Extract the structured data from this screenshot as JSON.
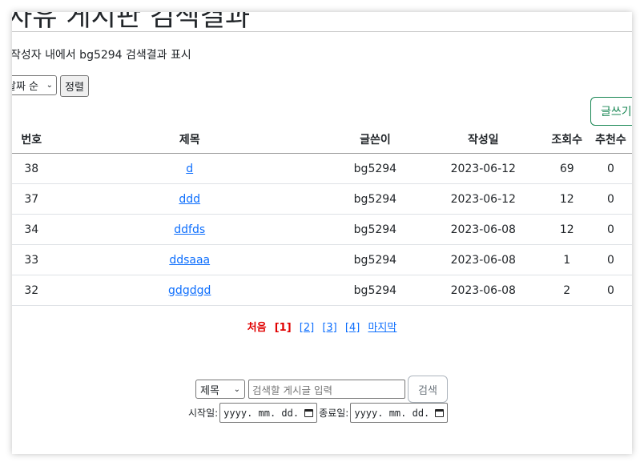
{
  "page": {
    "title": "자유 게시판 검색결과",
    "summary": "작성자 내에서 bg5294 검색결과 표시"
  },
  "controls": {
    "sort_value": "날짜 순",
    "sort_button": "정렬",
    "write_button": "글쓰기"
  },
  "table": {
    "headers": [
      "번호",
      "제목",
      "글쓴이",
      "작성일",
      "조회수",
      "추천수"
    ],
    "rows": [
      {
        "no": "38",
        "title": "d",
        "author": "bg5294",
        "date": "2023-06-12",
        "views": "69",
        "likes": "0"
      },
      {
        "no": "37",
        "title": "ddd",
        "author": "bg5294",
        "date": "2023-06-12",
        "views": "12",
        "likes": "0"
      },
      {
        "no": "34",
        "title": "ddfds",
        "author": "bg5294",
        "date": "2023-06-08",
        "views": "12",
        "likes": "0"
      },
      {
        "no": "33",
        "title": "ddsaaa",
        "author": "bg5294",
        "date": "2023-06-08",
        "views": "1",
        "likes": "0"
      },
      {
        "no": "32",
        "title": "gdgdgd",
        "author": "bg5294",
        "date": "2023-06-08",
        "views": "2",
        "likes": "0"
      }
    ]
  },
  "pagination": {
    "first": "처음",
    "current": "[1]",
    "pages": [
      "[2]",
      "[3]",
      "[4]"
    ],
    "last": "마지막"
  },
  "search": {
    "field_value": "제목",
    "placeholder": "검색할 게시글 입력",
    "button": "검색",
    "start_label": "시작일:",
    "end_label": "종료일:",
    "date_placeholder": "yyyy. mm. dd."
  },
  "colors": {
    "link": "#0d6efd",
    "active_page": "#e00000",
    "write_button": "#198754"
  }
}
